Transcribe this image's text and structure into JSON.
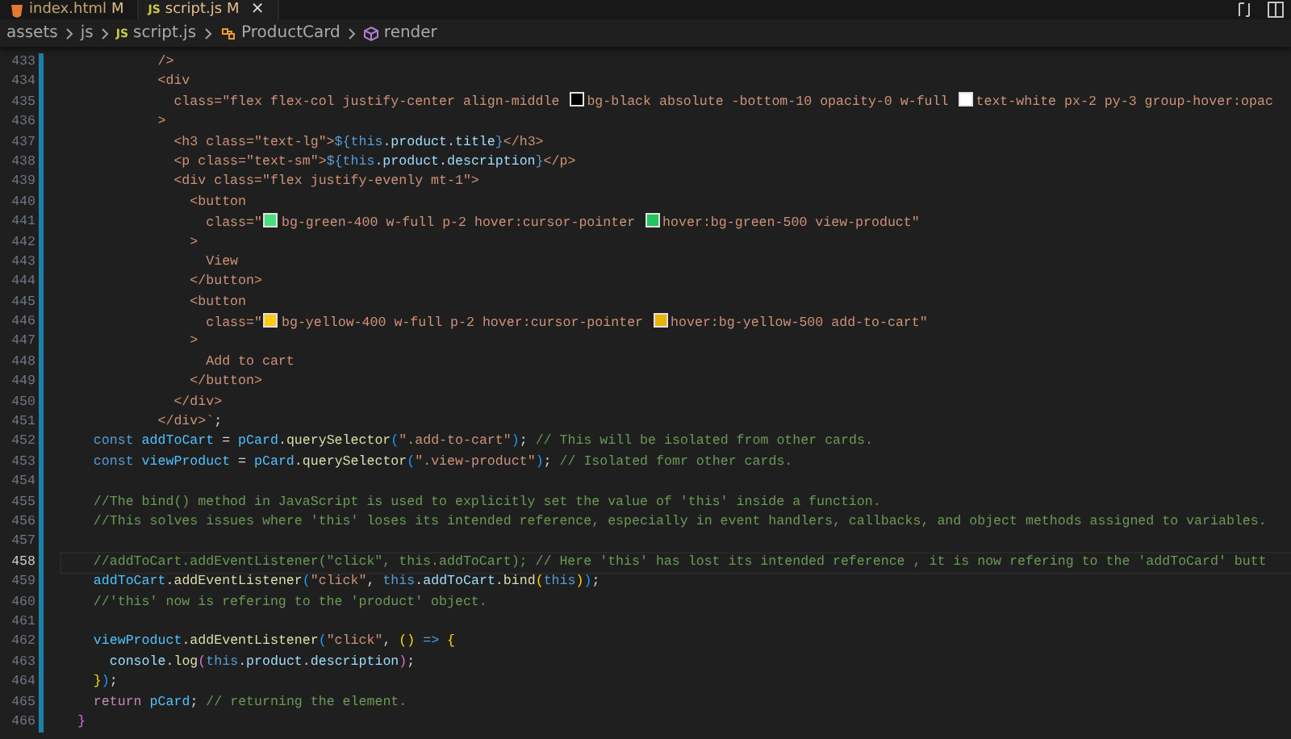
{
  "tabs": [
    {
      "kind": "html",
      "label": "index.html",
      "badge": "M",
      "selected": false
    },
    {
      "icon_text": "JS",
      "kind": "js",
      "label": "script.js",
      "badge": "M",
      "selected": true,
      "close": "×"
    }
  ],
  "breadcrumb": [
    {
      "kind": "folder",
      "label": "assets"
    },
    {
      "kind": "folder",
      "label": "js"
    },
    {
      "kind": "file",
      "icon_text": "JS",
      "label": "script.js"
    },
    {
      "kind": "class",
      "label": "ProductCard"
    },
    {
      "kind": "method",
      "label": "render"
    }
  ],
  "lines": [
    {
      "number": "433",
      "current": false,
      "modified": true,
      "tokens": [
        {
          "kind": "str",
          "text": "            />"
        }
      ]
    },
    {
      "number": "434",
      "current": false,
      "modified": true,
      "tokens": [
        {
          "kind": "str",
          "text": "            <div"
        }
      ]
    },
    {
      "number": "435",
      "current": false,
      "modified": true,
      "tokens": [
        {
          "kind": "str",
          "text": "              class=\"flex flex-col justify-center align-middle "
        },
        {
          "kind": "swatch",
          "color": "#000000"
        },
        {
          "kind": "str",
          "text": "bg-black absolute -bottom-10 opacity-0 w-full "
        },
        {
          "kind": "swatch",
          "color": "#ffffff"
        },
        {
          "kind": "str",
          "text": "text-white px-2 py-3 group-hover:opac"
        }
      ]
    },
    {
      "number": "436",
      "current": false,
      "modified": true,
      "tokens": [
        {
          "kind": "str",
          "text": "            >"
        }
      ]
    },
    {
      "number": "437",
      "current": false,
      "modified": true,
      "tokens": [
        {
          "kind": "str",
          "text": "              <h3 class=\"text-lg\">"
        },
        {
          "kind": "tmpl",
          "text": "${"
        },
        {
          "kind": "kw",
          "text": "this"
        },
        {
          "kind": "var",
          "text": ".product.title"
        },
        {
          "kind": "tmpl",
          "text": "}"
        },
        {
          "kind": "str",
          "text": "</h3>"
        }
      ]
    },
    {
      "number": "438",
      "current": false,
      "modified": true,
      "tokens": [
        {
          "kind": "str",
          "text": "              <p class=\"text-sm\">"
        },
        {
          "kind": "tmpl",
          "text": "${"
        },
        {
          "kind": "kw",
          "text": "this"
        },
        {
          "kind": "var",
          "text": ".product.description"
        },
        {
          "kind": "tmpl",
          "text": "}"
        },
        {
          "kind": "str",
          "text": "</p>"
        }
      ]
    },
    {
      "number": "439",
      "current": false,
      "modified": true,
      "tokens": [
        {
          "kind": "str",
          "text": "              <div class=\"flex justify-evenly mt-1\">"
        }
      ]
    },
    {
      "number": "440",
      "current": false,
      "modified": true,
      "tokens": [
        {
          "kind": "str",
          "text": "                <button"
        }
      ]
    },
    {
      "number": "441",
      "current": false,
      "modified": true,
      "tokens": [
        {
          "kind": "str",
          "text": "                  class=\""
        },
        {
          "kind": "swatch",
          "color": "#4ade80"
        },
        {
          "kind": "str",
          "text": "bg-green-400 w-full p-2 hover:cursor-pointer "
        },
        {
          "kind": "swatch",
          "color": "#22c55e"
        },
        {
          "kind": "str",
          "text": "hover:bg-green-500 view-product\""
        }
      ]
    },
    {
      "number": "442",
      "current": false,
      "modified": true,
      "tokens": [
        {
          "kind": "str",
          "text": "                >"
        }
      ]
    },
    {
      "number": "443",
      "current": false,
      "modified": true,
      "tokens": [
        {
          "kind": "str",
          "text": "                  View"
        }
      ]
    },
    {
      "number": "444",
      "current": false,
      "modified": true,
      "tokens": [
        {
          "kind": "str",
          "text": "                </button>"
        }
      ]
    },
    {
      "number": "445",
      "current": false,
      "modified": true,
      "tokens": [
        {
          "kind": "str",
          "text": "                <button"
        }
      ]
    },
    {
      "number": "446",
      "current": false,
      "modified": true,
      "tokens": [
        {
          "kind": "str",
          "text": "                  class=\""
        },
        {
          "kind": "swatch",
          "color": "#facc15"
        },
        {
          "kind": "str",
          "text": "bg-yellow-400 w-full p-2 hover:cursor-pointer "
        },
        {
          "kind": "swatch",
          "color": "#eab308"
        },
        {
          "kind": "str",
          "text": "hover:bg-yellow-500 add-to-cart\""
        }
      ]
    },
    {
      "number": "447",
      "current": false,
      "modified": true,
      "tokens": [
        {
          "kind": "str",
          "text": "                >"
        }
      ]
    },
    {
      "number": "448",
      "current": false,
      "modified": true,
      "tokens": [
        {
          "kind": "str",
          "text": "                  Add to cart"
        }
      ]
    },
    {
      "number": "449",
      "current": false,
      "modified": true,
      "tokens": [
        {
          "kind": "str",
          "text": "                </button>"
        }
      ]
    },
    {
      "number": "450",
      "current": false,
      "modified": true,
      "tokens": [
        {
          "kind": "str",
          "text": "              </div>"
        }
      ]
    },
    {
      "number": "451",
      "current": false,
      "modified": true,
      "tokens": [
        {
          "kind": "str",
          "text": "            </div>`"
        },
        {
          "kind": "punct",
          "text": ";"
        }
      ]
    },
    {
      "number": "452",
      "current": false,
      "modified": true,
      "tokens": [
        {
          "kind": "kw",
          "text": "    const "
        },
        {
          "kind": "cst",
          "text": "addToCart"
        },
        {
          "kind": "punct",
          "text": " = "
        },
        {
          "kind": "cst",
          "text": "pCard"
        },
        {
          "kind": "punct",
          "text": "."
        },
        {
          "kind": "fn",
          "text": "querySelector"
        },
        {
          "kind": "br3",
          "text": "("
        },
        {
          "kind": "str",
          "text": "\".add-to-cart\""
        },
        {
          "kind": "br3",
          "text": ")"
        },
        {
          "kind": "punct",
          "text": "; "
        },
        {
          "kind": "cm",
          "text": "// This will be isolated from other cards."
        }
      ]
    },
    {
      "number": "453",
      "current": false,
      "modified": true,
      "tokens": [
        {
          "kind": "kw",
          "text": "    const "
        },
        {
          "kind": "cst",
          "text": "viewProduct"
        },
        {
          "kind": "punct",
          "text": " = "
        },
        {
          "kind": "cst",
          "text": "pCard"
        },
        {
          "kind": "punct",
          "text": "."
        },
        {
          "kind": "fn",
          "text": "querySelector"
        },
        {
          "kind": "br3",
          "text": "("
        },
        {
          "kind": "str",
          "text": "\".view-product\""
        },
        {
          "kind": "br3",
          "text": ")"
        },
        {
          "kind": "punct",
          "text": "; "
        },
        {
          "kind": "cm",
          "text": "// Isolated fomr other cards."
        }
      ]
    },
    {
      "number": "454",
      "current": false,
      "modified": true
    },
    {
      "number": "455",
      "current": false,
      "modified": true,
      "tokens": [
        {
          "kind": "cm",
          "text": "    //The bind() method in JavaScript is used to explicitly set the value of 'this' inside a function."
        }
      ]
    },
    {
      "number": "456",
      "current": false,
      "modified": true,
      "tokens": [
        {
          "kind": "cm",
          "text": "    //This solves issues where 'this' loses its intended reference, especially in event handlers, callbacks, and object methods assigned to variables."
        }
      ]
    },
    {
      "number": "457",
      "current": false,
      "modified": true
    },
    {
      "number": "458",
      "current": true,
      "modified": true,
      "tokens": [
        {
          "kind": "cm",
          "text": "    //addToCart.addEventListener(\"click\", this.addToCart); // Here 'this' has lost its intended reference , it is now refering to the 'addToCard' butt"
        }
      ]
    },
    {
      "number": "459",
      "current": false,
      "modified": true,
      "tokens": [
        {
          "kind": "cst",
          "text": "    addToCart"
        },
        {
          "kind": "punct",
          "text": "."
        },
        {
          "kind": "fn",
          "text": "addEventListener"
        },
        {
          "kind": "br3",
          "text": "("
        },
        {
          "kind": "str",
          "text": "\"click\""
        },
        {
          "kind": "punct",
          "text": ", "
        },
        {
          "kind": "kw",
          "text": "this"
        },
        {
          "kind": "punct",
          "text": "."
        },
        {
          "kind": "var",
          "text": "addToCart"
        },
        {
          "kind": "punct",
          "text": "."
        },
        {
          "kind": "fn",
          "text": "bind"
        },
        {
          "kind": "br1",
          "text": "("
        },
        {
          "kind": "kw",
          "text": "this"
        },
        {
          "kind": "br1",
          "text": ")"
        },
        {
          "kind": "br3",
          "text": ")"
        },
        {
          "kind": "punct",
          "text": ";"
        }
      ]
    },
    {
      "number": "460",
      "current": false,
      "modified": true,
      "tokens": [
        {
          "kind": "cm",
          "text": "    //'this' now is refering to the 'product' object."
        }
      ]
    },
    {
      "number": "461",
      "current": false,
      "modified": true
    },
    {
      "number": "462",
      "current": false,
      "modified": true,
      "tokens": [
        {
          "kind": "cst",
          "text": "    viewProduct"
        },
        {
          "kind": "punct",
          "text": "."
        },
        {
          "kind": "fn",
          "text": "addEventListener"
        },
        {
          "kind": "br3",
          "text": "("
        },
        {
          "kind": "str",
          "text": "\"click\""
        },
        {
          "kind": "punct",
          "text": ", "
        },
        {
          "kind": "br1",
          "text": "()"
        },
        {
          "kind": "kw",
          "text": " => "
        },
        {
          "kind": "br1",
          "text": "{"
        }
      ]
    },
    {
      "number": "463",
      "current": false,
      "modified": true,
      "tokens": [
        {
          "kind": "var",
          "text": "      console"
        },
        {
          "kind": "punct",
          "text": "."
        },
        {
          "kind": "fn",
          "text": "log"
        },
        {
          "kind": "br2",
          "text": "("
        },
        {
          "kind": "kw",
          "text": "this"
        },
        {
          "kind": "punct",
          "text": "."
        },
        {
          "kind": "var",
          "text": "product"
        },
        {
          "kind": "punct",
          "text": "."
        },
        {
          "kind": "var",
          "text": "description"
        },
        {
          "kind": "br2",
          "text": ")"
        },
        {
          "kind": "punct",
          "text": ";"
        }
      ]
    },
    {
      "number": "464",
      "current": false,
      "modified": true,
      "tokens": [
        {
          "kind": "br1",
          "text": "    }"
        },
        {
          "kind": "br3",
          "text": ")"
        },
        {
          "kind": "punct",
          "text": ";"
        }
      ]
    },
    {
      "number": "465",
      "current": false,
      "modified": true,
      "tokens": [
        {
          "kind": "ctl",
          "text": "    return "
        },
        {
          "kind": "cst",
          "text": "pCard"
        },
        {
          "kind": "punct",
          "text": "; "
        },
        {
          "kind": "cm",
          "text": "// returning the element."
        }
      ]
    },
    {
      "number": "466",
      "current": false,
      "modified": true,
      "tokens": [
        {
          "kind": "br2",
          "text": "  }"
        }
      ]
    }
  ]
}
